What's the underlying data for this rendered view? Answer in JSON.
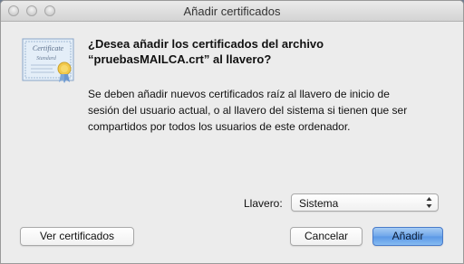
{
  "window": {
    "title": "Añadir certificados"
  },
  "dialog": {
    "heading_line1": "¿Desea añadir los certificados del archivo",
    "heading_line2": "“pruebasMAILCA.crt” al llavero?",
    "body_line1": "Se deben añadir nuevos certificados raíz al llavero de inicio de",
    "body_line2": "sesión del usuario actual, o al llavero del sistema si tienen que ser",
    "body_line3": "compartidos por todos los usuarios de este ordenador.",
    "icon": "certificate-icon",
    "icon_text_line1": "Certificate",
    "icon_text_line2": "Standard"
  },
  "keychain": {
    "label": "Llavero:",
    "selected": "Sistema"
  },
  "buttons": {
    "view_certificates": "Ver certificados",
    "cancel": "Cancelar",
    "add": "Añadir"
  },
  "colors": {
    "default_button": "#6ea6ea",
    "window_background": "#ececec"
  }
}
